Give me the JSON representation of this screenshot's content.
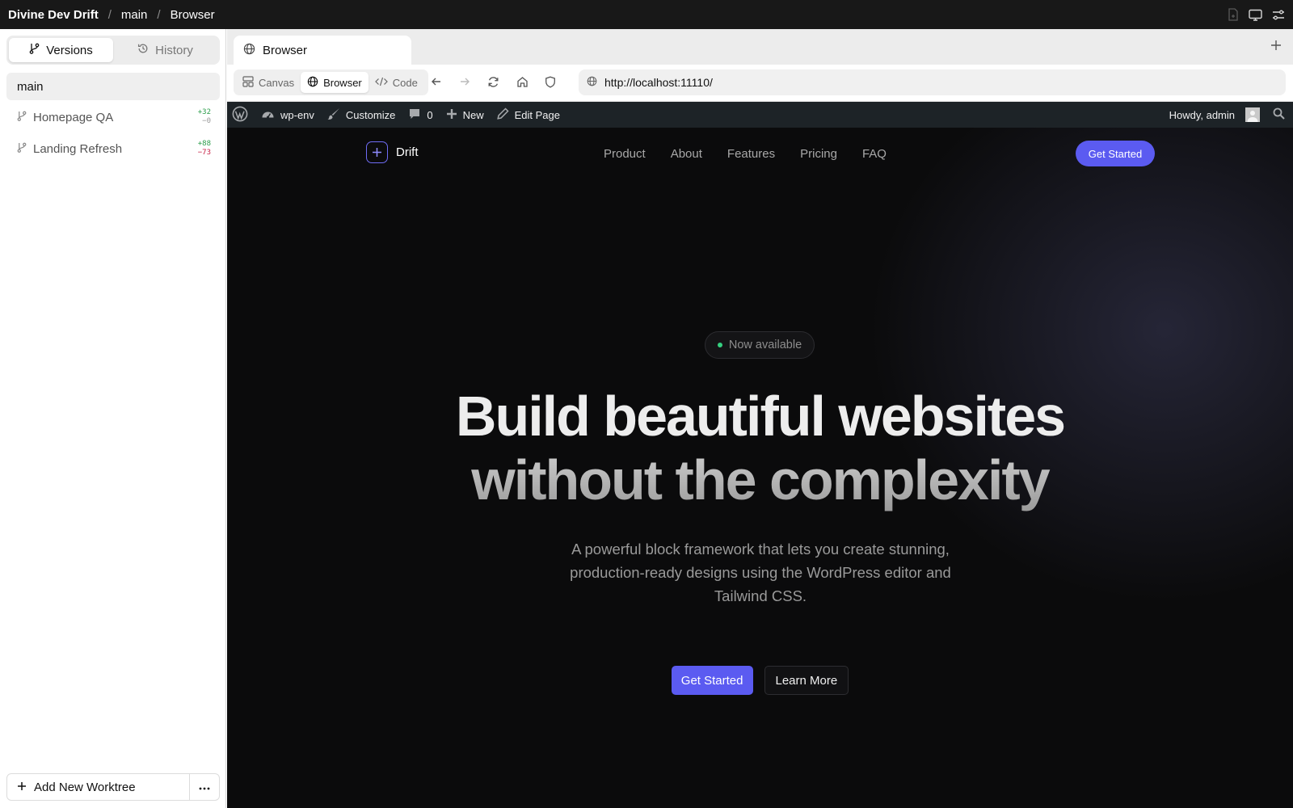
{
  "breadcrumb": {
    "project": "Divine Dev Drift",
    "branch": "main",
    "view": "Browser"
  },
  "titlebar_icons": [
    "file-icon",
    "monitor-icon",
    "sliders-icon"
  ],
  "sidebar": {
    "tabs": [
      {
        "label": "Versions",
        "icon": "branch-icon",
        "active": true
      },
      {
        "label": "History",
        "icon": "history-icon",
        "active": false
      }
    ],
    "main_worktree": "main",
    "worktrees": [
      {
        "label": "Homepage QA",
        "added": "+32",
        "removed": "−0"
      },
      {
        "label": "Landing Refresh",
        "added": "+88",
        "removed": "−73"
      }
    ],
    "add_label": "Add New Worktree"
  },
  "browser": {
    "tab_title": "Browser",
    "modes": [
      {
        "label": "Canvas",
        "icon": "layout-icon"
      },
      {
        "label": "Browser",
        "icon": "globe-icon",
        "active": true
      },
      {
        "label": "Code",
        "icon": "code-icon"
      }
    ],
    "url": "http://localhost:11110/"
  },
  "wpbar": {
    "site_name": "wp-env",
    "customize": "Customize",
    "comments": "0",
    "new": "New",
    "edit": "Edit Page",
    "howdy": "Howdy, admin"
  },
  "site": {
    "brand": "Drift",
    "menu": [
      "Product",
      "About",
      "Features",
      "Pricing",
      "FAQ"
    ],
    "nav_cta": "Get Started",
    "badge": "Now available",
    "title_line1": "Build beautiful websites",
    "title_line2": "without the complexity",
    "subtitle_line1": "A powerful block framework that lets you create stunning,",
    "subtitle_line2": "production-ready designs using the WordPress editor and",
    "subtitle_line3": "Tailwind CSS.",
    "primary_cta": "Get Started",
    "secondary_cta": "Learn More"
  },
  "colors": {
    "accent": "#5b5bf1",
    "badge_dot": "#35d07f",
    "added": "#2a9d4a",
    "removed": "#c82348"
  }
}
